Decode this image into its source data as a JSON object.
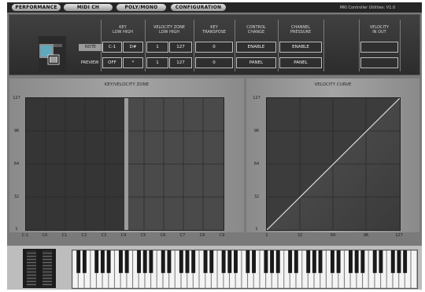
{
  "tabs": [
    {
      "label": "PERFORMANCE"
    },
    {
      "label": "MIDI CH"
    },
    {
      "label": "POLY/MONO"
    },
    {
      "label": "CONFIGURATION"
    }
  ],
  "app_title": "MKI Controller Utilities: V1.0",
  "columns": [
    {
      "top": "KEY",
      "bottom": "LOW   HIGH"
    },
    {
      "top": "VELOCITY ZONE",
      "bottom": "LOW   HIGH"
    },
    {
      "top": "KEY",
      "bottom": "TRANSPOSE"
    },
    {
      "top": "CONTROL",
      "bottom": "CHANGE"
    },
    {
      "top": "CHANNEL",
      "bottom": "PRESSURE"
    },
    {
      "top": "VELOCITY",
      "bottom": "IN    OUT"
    }
  ],
  "row_labels": [
    "NOTE",
    "PREVIEW"
  ],
  "row1": {
    "key_low": "C-1",
    "key_high": "D#",
    "vel_low": "1",
    "vel_high": "127",
    "transpose": "0",
    "cc": "ENABLE",
    "pressure": "ENABLE"
  },
  "row2": {
    "key_low": "OFF",
    "key_high": "*",
    "vel_low": "1",
    "vel_high": "127",
    "transpose": "0",
    "cc": "PANEL",
    "pressure": "PANEL"
  },
  "key_velocity": {
    "title": "KEY/VELOCITY ZONE",
    "y_ticks": [
      "127",
      "96",
      "64",
      "32",
      "1"
    ],
    "x_ticks": [
      "C-1",
      "C0",
      "C1",
      "C2",
      "C3",
      "C4",
      "C5",
      "C6",
      "C7",
      "C8",
      "C9"
    ]
  },
  "velocity_curve": {
    "title": "VELOCITY CURVE",
    "y_ticks": [
      "127",
      "96",
      "64",
      "32",
      "1"
    ],
    "x_ticks": [
      "1",
      "32",
      "64",
      "96",
      "127"
    ]
  },
  "colors": {
    "accent": "#9fa0a0",
    "panel_bg": "#333333",
    "selected_tone": "#5fa9bf"
  }
}
